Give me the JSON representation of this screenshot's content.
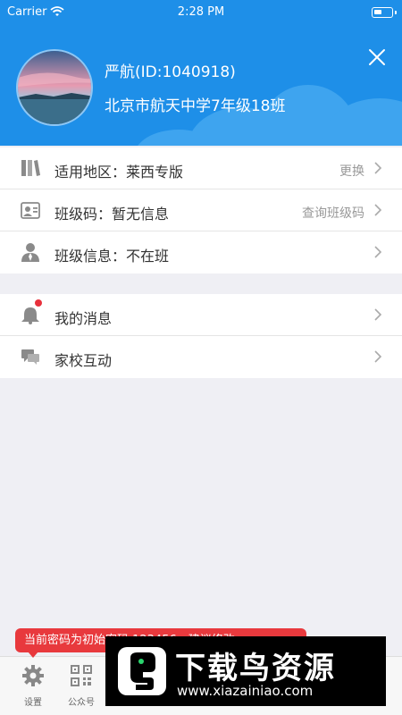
{
  "status_bar": {
    "carrier": "Carrier",
    "time": "2:28 PM"
  },
  "profile": {
    "name": "严航(ID:1040918)",
    "school": "北京市航天中学7年级18班"
  },
  "group1": [
    {
      "label": "适用地区：莱西专版",
      "action": "更换",
      "icon": "book-icon"
    },
    {
      "label": "班级码：暂无信息",
      "action": "查询班级码",
      "icon": "card-icon"
    },
    {
      "label": "班级信息：不在班",
      "action": "",
      "icon": "person-icon"
    }
  ],
  "group2": [
    {
      "label": "我的消息",
      "icon": "bell-icon",
      "badge": true
    },
    {
      "label": "家校互动",
      "icon": "chat-icon"
    }
  ],
  "toast": {
    "text": "当前密码为初始密码 123456，建议修改",
    "close": "×"
  },
  "tabs": [
    {
      "label": "设置",
      "icon": "gear-icon"
    },
    {
      "label": "公众号",
      "icon": "qrcode-icon"
    }
  ],
  "watermark": {
    "title": "下载鸟资源",
    "url": "www.xiazainiao.com"
  },
  "colors": {
    "header": "#1e8fe8",
    "toast": "#e8393d",
    "badge": "#e8313c"
  }
}
